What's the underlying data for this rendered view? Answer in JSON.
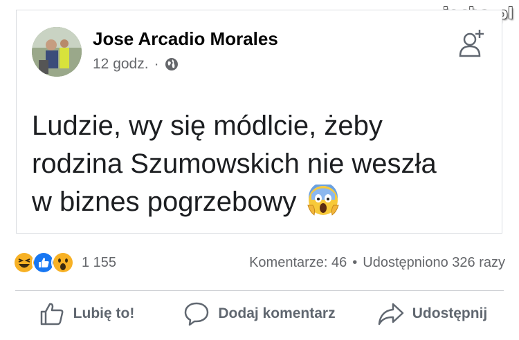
{
  "watermark": "www.wiocha.pl",
  "post": {
    "author": "Jose Arcadio Morales",
    "time": "12 godz.",
    "separator": "·",
    "text_line1": "Ludzie, wy się módlcie, żeby",
    "text_line2": "rodzina Szumowskich nie weszła",
    "text_line3": "w biznes pogrzebowy"
  },
  "stats": {
    "reaction_count": "1 155",
    "comments": "Komentarze: 46",
    "dot": "•",
    "shares": "Udostępniono 326 razy"
  },
  "actions": {
    "like_label": "Lubię to!",
    "comment_label": "Dodaj komentarz",
    "share_label": "Udostępnij"
  },
  "colors": {
    "like_blue": "#1877f2",
    "haha_yellow": "#f7b125",
    "muted_gray": "#65676b"
  },
  "icons": [
    "globe-icon",
    "add-friend-icon",
    "scream-emoji",
    "haha-reaction",
    "like-reaction",
    "wow-reaction",
    "thumbs-up-icon",
    "comment-icon",
    "share-icon"
  ]
}
